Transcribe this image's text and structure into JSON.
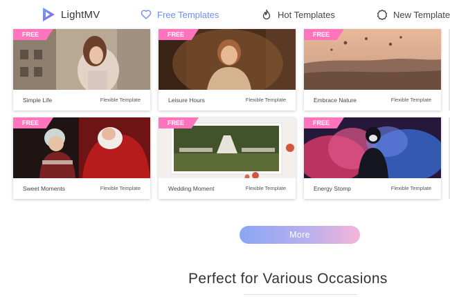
{
  "header": {
    "brand": "LightMV",
    "nav": [
      {
        "label": "Free Templates",
        "icon": "heart-icon",
        "active": true
      },
      {
        "label": "Hot Templates",
        "icon": "flame-icon",
        "active": false
      },
      {
        "label": "New Templates",
        "icon": "badge-icon",
        "active": false
      }
    ]
  },
  "templates": [
    {
      "badge": "FREE",
      "title": "Simple Life",
      "type": "Flexible Template"
    },
    {
      "badge": "FREE",
      "title": "Leisure Hours",
      "type": "Flexible Template"
    },
    {
      "badge": "FREE",
      "title": "Embrace Nature",
      "type": "Flexible Template"
    },
    {
      "badge": "FREE",
      "title": "Sweet Moments",
      "type": "Flexible Template"
    },
    {
      "badge": "FREE",
      "title": "Wedding Moment",
      "type": "Flexible Template"
    },
    {
      "badge": "FREE",
      "title": "Energy Stomp",
      "type": "Flexible Template"
    }
  ],
  "more_button": "More",
  "section": {
    "title": "Perfect for Various Occasions"
  },
  "colors": {
    "accent": "#6e8cf0",
    "badge": "#ff74bd",
    "button_start": "#8aa5f4",
    "button_end": "#f5b4d8"
  }
}
